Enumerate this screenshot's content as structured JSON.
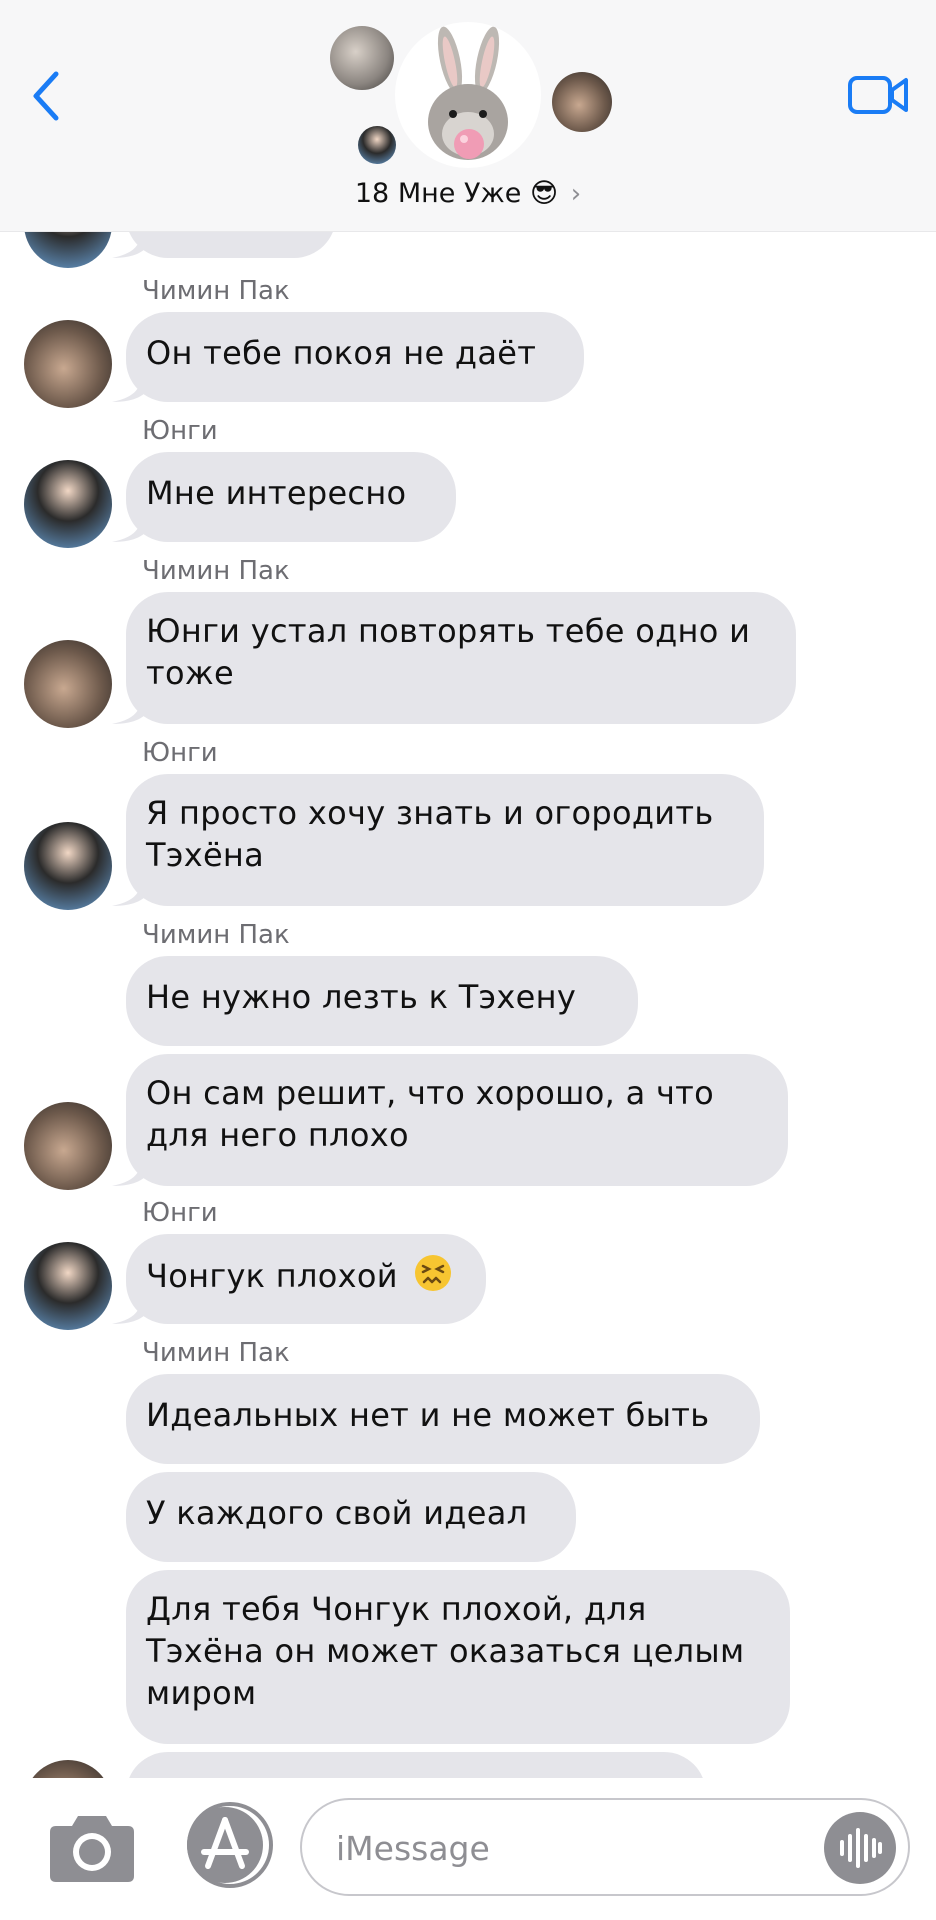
{
  "header": {
    "group_name": "18 Мне Уже",
    "group_emoji": "😎",
    "chevron": "›",
    "back_icon": "chevron-left-icon",
    "video_icon": "video-camera-icon"
  },
  "colors": {
    "accent": "#1a7cf5",
    "bubble": "#e5e5ea",
    "sender": "#6d6d72",
    "header_bg": "#f7f7f8"
  },
  "messages": [
    {
      "sender": "Чимин Пак",
      "text": "Он тебе покоя не даёт"
    },
    {
      "sender": "Юнги",
      "text": "Мне интересно"
    },
    {
      "sender": "Чимин Пак",
      "line1": "Юнги устал повторять тебе одно и",
      "line2": "тоже"
    },
    {
      "sender": "Юнги",
      "line1": "Я просто хочу знать и огородить",
      "line2": "Тэхёна"
    },
    {
      "sender": "Чимин Пак",
      "text": "Не нужно лезть  к Тэхену"
    },
    {
      "line1": "Он сам решит,  что хорошо,  а что",
      "line2": "для него плохо"
    },
    {
      "sender": "Юнги",
      "text": "Чонгук плохой",
      "emoji": "😖"
    },
    {
      "sender": "Чимин Пак",
      "text": "Идеальных нет и не может быть"
    },
    {
      "text": "У каждого свой идеал"
    },
    {
      "line1": "Для тебя Чонгук плохой,  для",
      "line2": "Тэхёна он может оказаться целым",
      "line3": "миром"
    }
  ],
  "composer": {
    "placeholder": "iMessage",
    "camera_icon": "camera-icon",
    "appstore_icon": "app-store-icon",
    "audio_icon": "audio-waveform-icon"
  }
}
